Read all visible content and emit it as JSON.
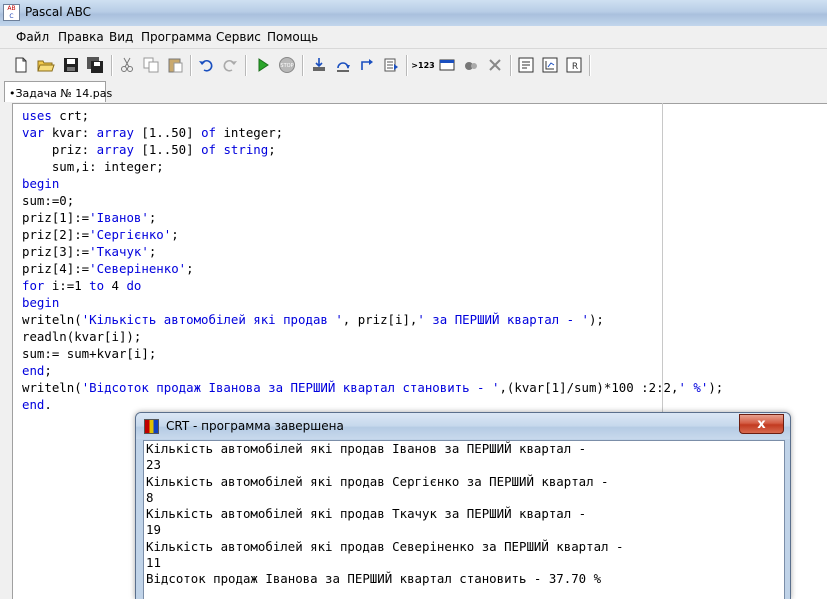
{
  "window": {
    "title": "Pascal ABC"
  },
  "menu": [
    "Файл",
    "Правка",
    "Вид",
    "Программа",
    "Сервис",
    "Помощь"
  ],
  "toolbar": {
    "trace_label": ">123"
  },
  "tabs": [
    {
      "label": "•Задача № 14.pas"
    }
  ],
  "editor": {
    "lines": [
      [
        {
          "t": "uses",
          "k": "kw"
        },
        {
          "t": " crt;"
        }
      ],
      [
        {
          "t": "var",
          "k": "kw"
        },
        {
          "t": " kvar: "
        },
        {
          "t": "array",
          "k": "kw"
        },
        {
          "t": " [1..50] "
        },
        {
          "t": "of",
          "k": "kw"
        },
        {
          "t": " integer;"
        }
      ],
      [
        {
          "t": "    priz: "
        },
        {
          "t": "array",
          "k": "kw"
        },
        {
          "t": " [1..50] "
        },
        {
          "t": "of",
          "k": "kw"
        },
        {
          "t": " "
        },
        {
          "t": "string",
          "k": "kw"
        },
        {
          "t": ";"
        }
      ],
      [
        {
          "t": "    sum,i: integer;"
        }
      ],
      [
        {
          "t": "begin",
          "k": "kw"
        }
      ],
      [
        {
          "t": "sum:=0;"
        }
      ],
      [
        {
          "t": "priz[1]:="
        },
        {
          "t": "'Іванов'",
          "k": "str"
        },
        {
          "t": ";"
        }
      ],
      [
        {
          "t": "priz[2]:="
        },
        {
          "t": "'Сергієнко'",
          "k": "str"
        },
        {
          "t": ";"
        }
      ],
      [
        {
          "t": "priz[3]:="
        },
        {
          "t": "'Ткачук'",
          "k": "str"
        },
        {
          "t": ";"
        }
      ],
      [
        {
          "t": "priz[4]:="
        },
        {
          "t": "'Северіненко'",
          "k": "str"
        },
        {
          "t": ";"
        }
      ],
      [
        {
          "t": "for",
          "k": "kw"
        },
        {
          "t": " i:=1 "
        },
        {
          "t": "to",
          "k": "kw"
        },
        {
          "t": " 4 "
        },
        {
          "t": "do",
          "k": "kw"
        }
      ],
      [
        {
          "t": "begin",
          "k": "kw"
        }
      ],
      [
        {
          "t": "writeln("
        },
        {
          "t": "'Кількість автомобілей які продав '",
          "k": "str"
        },
        {
          "t": ", priz[i],"
        },
        {
          "t": "' за ПЕРШИЙ квартал - '",
          "k": "str"
        },
        {
          "t": ");"
        }
      ],
      [
        {
          "t": "readln(kvar[i]);"
        }
      ],
      [
        {
          "t": "sum:= sum+kvar[i];"
        }
      ],
      [
        {
          "t": "end",
          "k": "kw"
        },
        {
          "t": ";"
        }
      ],
      [
        {
          "t": "writeln("
        },
        {
          "t": "'Відсоток продаж Іванова за ПЕРШИЙ квартал становить - '",
          "k": "str"
        },
        {
          "t": ",(kvar[1]/sum)*100 :2:2,"
        },
        {
          "t": "' %'",
          "k": "str"
        },
        {
          "t": ");"
        }
      ],
      [
        {
          "t": "end",
          "k": "kw"
        },
        {
          "t": "."
        }
      ]
    ]
  },
  "crt": {
    "title": "CRT - программа завершена",
    "close_label": "x",
    "output": [
      "Кількість автомобілей які продав Іванов за ПЕРШИЙ квартал -",
      "23",
      "Кількість автомобілей які продав Сергієнко за ПЕРШИЙ квартал -",
      "8",
      "Кількість автомобілей які продав Ткачук за ПЕРШИЙ квартал -",
      "19",
      "Кількість автомобілей які продав Северіненко за ПЕРШИЙ квартал -",
      "11",
      "Відсоток продаж Іванова за ПЕРШИЙ квартал становить - 37.70 %"
    ]
  }
}
